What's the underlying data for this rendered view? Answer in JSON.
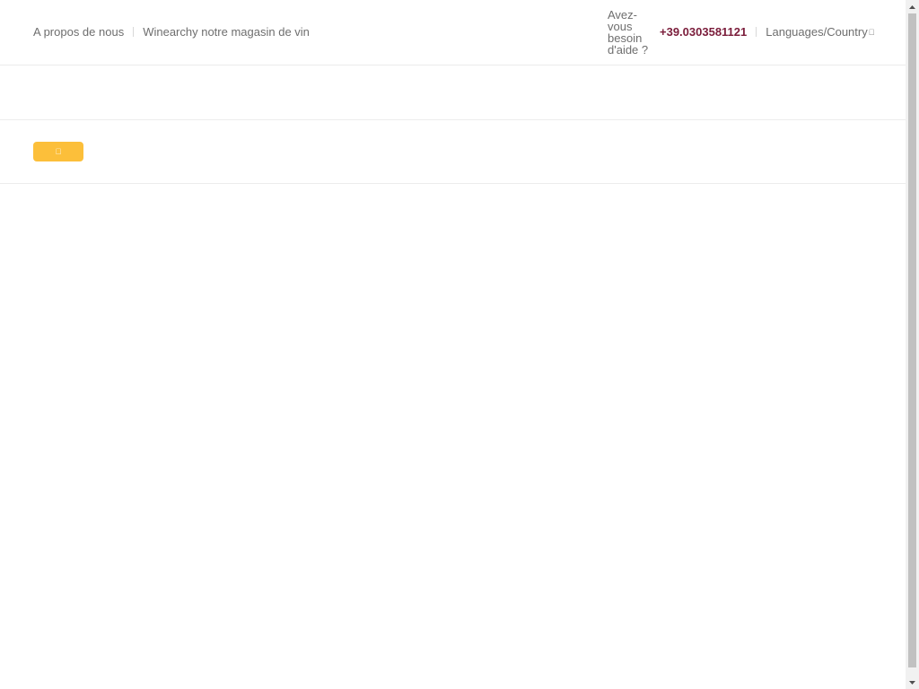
{
  "topbar": {
    "links": [
      {
        "label": "A propos de nous"
      },
      {
        "label": "Winearchy notre magasin de vin"
      }
    ],
    "help_text": "Avez-vous besoin d'aide ?",
    "phone": "+39.0303581121",
    "language_label": "Languages/Country",
    "language_caret": ""
  },
  "secondary": {
    "button_icon": ""
  },
  "icons": {
    "button": "ellipsis-vertical-icon",
    "language_caret": "caret-down-icon"
  },
  "colors": {
    "accent_yellow": "#fcbf3a",
    "phone_color": "#7a1c3a",
    "text_gray": "#6e6e6e"
  }
}
